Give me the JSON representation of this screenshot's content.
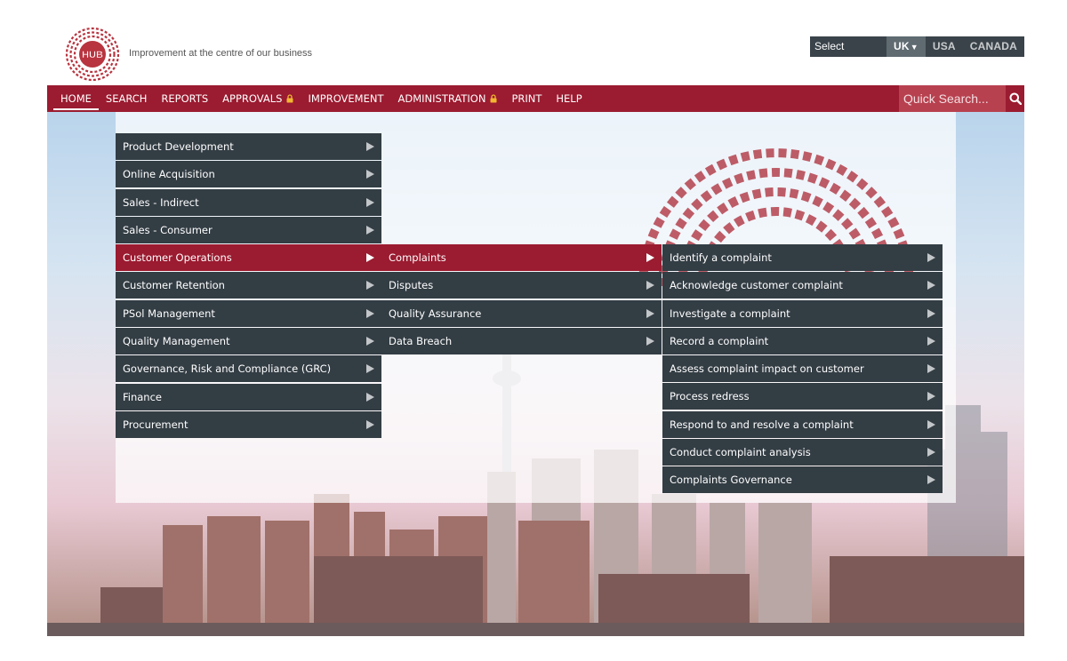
{
  "header": {
    "logo_text": "HUB",
    "tagline": "Improvement at the centre of our business"
  },
  "region": {
    "label": "Select Region:",
    "options": [
      "UK",
      "USA",
      "CANADA"
    ],
    "selected": "UK"
  },
  "nav": {
    "items": [
      "HOME",
      "SEARCH",
      "REPORTS",
      "APPROVALS",
      "IMPROVEMENT",
      "ADMINISTRATION",
      "PRINT",
      "HELP"
    ],
    "active": "HOME",
    "locked": [
      "APPROVALS",
      "ADMINISTRATION"
    ],
    "search_placeholder": "Quick Search..."
  },
  "menu_level1": {
    "items": [
      "Product Development",
      "Online Acquisition",
      "Sales - Indirect",
      "Sales - Consumer",
      "Customer Operations",
      "Customer Retention",
      "PSol Management",
      "Quality Management",
      "Governance, Risk and Compliance (GRC)",
      "Finance",
      "Procurement"
    ],
    "active": "Customer Operations"
  },
  "menu_level2": {
    "items": [
      "Complaints",
      "Disputes",
      "Quality Assurance",
      "Data Breach"
    ],
    "active": "Complaints"
  },
  "menu_level3": {
    "items": [
      "Identify a complaint",
      "Acknowledge customer complaint",
      "Investigate a complaint",
      "Record a complaint",
      "Assess complaint impact on customer",
      "Process redress",
      "Respond to and resolve a complaint",
      "Conduct complaint analysis",
      "Complaints Governance"
    ]
  },
  "icons": {
    "lock": "lock-icon",
    "search": "search-icon",
    "submenu": "chevron-right-icon",
    "dropdown": "caret-down-icon"
  },
  "colors": {
    "brand": "#9b1b30",
    "menu_bg": "#333d44",
    "region_bg": "#3a434a"
  }
}
